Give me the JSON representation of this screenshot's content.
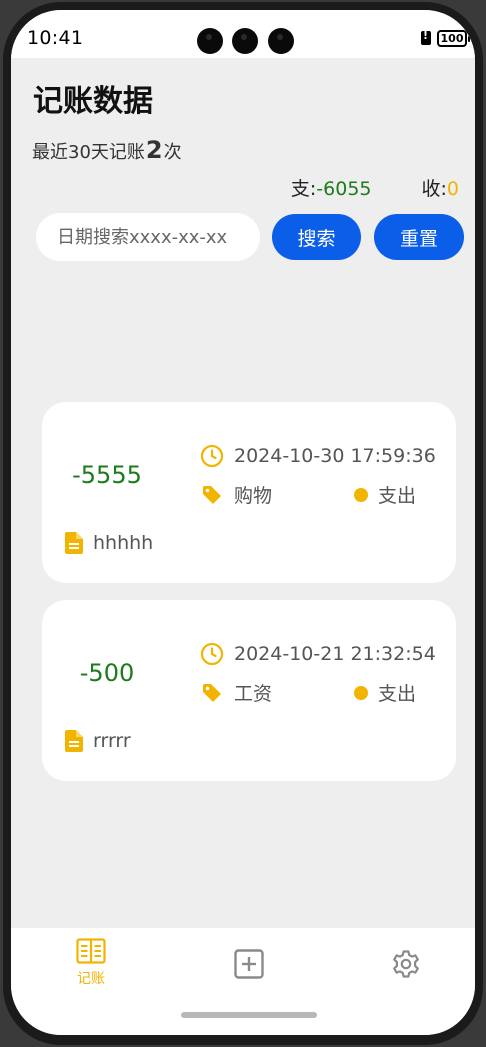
{
  "status_bar": {
    "time": "10:41",
    "battery": "100"
  },
  "header": {
    "title": "记账数据"
  },
  "summary": {
    "prefix": "最近30天记账",
    "count": "2",
    "suffix": "次"
  },
  "totals": {
    "expense_label": "支:",
    "expense_value": "-6055",
    "income_label": "收:",
    "income_value": "0"
  },
  "search": {
    "placeholder": "日期搜索xxxx-xx-xx",
    "value": "",
    "search_label": "搜索",
    "reset_label": "重置"
  },
  "records": [
    {
      "amount": "-5555",
      "datetime": "2024-10-30 17:59:36",
      "category": "购物",
      "type": "支出",
      "note": "hhhhh"
    },
    {
      "amount": "-500",
      "datetime": "2024-10-21 21:32:54",
      "category": "工资",
      "type": "支出",
      "note": "rrrrr"
    }
  ],
  "tabbar": {
    "items": [
      {
        "label": "记账",
        "icon": "book-icon",
        "active": true
      },
      {
        "label": "",
        "icon": "add-square-icon",
        "active": false
      },
      {
        "label": "",
        "icon": "gear-icon",
        "active": false
      }
    ]
  },
  "colors": {
    "accent": "#f1b400",
    "primary_button": "#0b5ee8",
    "expense_green": "#1d7a1d",
    "background": "#eeeeee"
  }
}
